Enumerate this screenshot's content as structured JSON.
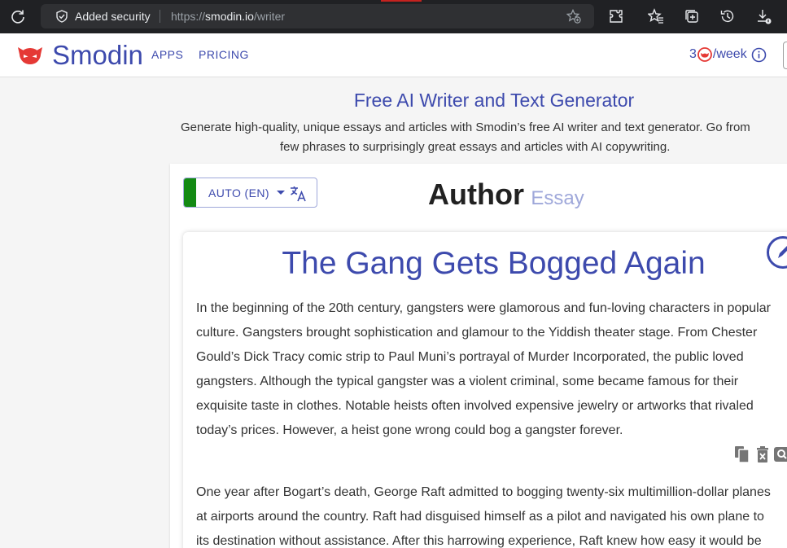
{
  "browser": {
    "security_label": "Added security",
    "url_prefix": "https://",
    "url_domain": "smodin.io",
    "url_path": "/writer"
  },
  "header": {
    "brand": "Smodin",
    "nav": [
      "APPS",
      "PRICING"
    ],
    "credits_prefix": "3",
    "credits_suffix": "/week",
    "accent_color": "#3d4aad"
  },
  "intro": {
    "title": "Free AI Writer and Text Generator",
    "subtitle_line1": "Generate high-quality, unique essays and articles with Smodin’s free AI writer and text generator. Go from",
    "subtitle_line2": "few phrases to surprisingly great essays and articles with AI copywriting."
  },
  "editor": {
    "language": "AUTO (EN)",
    "heading_main": "Author",
    "heading_sub": "Essay"
  },
  "essay": {
    "title": "The Gang Gets Bogged Again",
    "paragraph1": [
      "In the beginning of the 20th century, gangsters were glamorous and fun-loving characters in popular",
      "culture. Gangsters brought sophistication and glamour to the Yiddish theater stage. From Chester",
      "Gould’s Dick Tracy comic strip to Paul Muni’s portrayal of Murder Incorporated, the public loved",
      "gangsters. Although the typical gangster was a violent criminal, some became famous for their",
      "exquisite taste in clothes. Notable heists often involved expensive jewelry or artworks that rivaled",
      "today’s prices. However, a heist gone wrong could bog a gangster forever."
    ],
    "paragraph2": [
      "One year after Bogart’s death, George Raft admitted to bogging twenty-six multimillion-dollar planes",
      "at airports around the country. Raft had disguised himself as a pilot and navigated his own plane to",
      "its destination without assistance. After this harrowing experience, Raft knew how easy it would be"
    ],
    "icons": [
      "copy-icon",
      "delete-icon",
      "search-icon"
    ]
  }
}
